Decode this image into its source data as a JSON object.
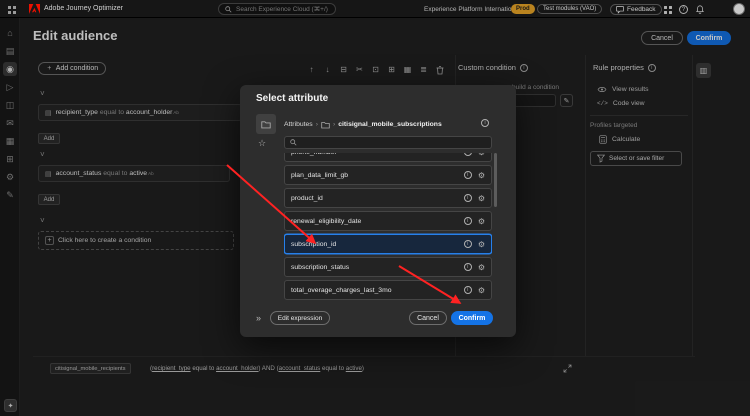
{
  "colors": {
    "accent_blue": "#1473e6",
    "selection_blue": "#2680eb",
    "arrow_red": "#ff2222",
    "env_badge_bg": "#b9831f"
  },
  "topbar": {
    "app_title": "Adobe Journey Optimizer",
    "search_placeholder": "Search Experience Cloud (⌘+/)",
    "org_name": "Experience Platform International...",
    "env_badge": "Prod",
    "sandbox_badge": "Test modules (VAO)",
    "feedback_label": "Feedback"
  },
  "sidebar": {
    "items": [
      {
        "name": "home",
        "glyph": "⌂"
      },
      {
        "name": "campaigns",
        "glyph": "▤"
      },
      {
        "name": "audiences",
        "glyph": "◉"
      },
      {
        "name": "journeys",
        "glyph": "▷"
      },
      {
        "name": "decisioning",
        "glyph": "◫"
      },
      {
        "name": "channels",
        "glyph": "✉"
      },
      {
        "name": "analysis",
        "glyph": "▦"
      },
      {
        "name": "assets",
        "glyph": "⊞"
      },
      {
        "name": "administration",
        "glyph": "⚙"
      },
      {
        "name": "configuration",
        "glyph": "✎"
      }
    ]
  },
  "header": {
    "title": "Edit audience",
    "cancel_label": "Cancel",
    "confirm_label": "Confirm"
  },
  "toolbar": {
    "icons": [
      {
        "name": "move-up",
        "glyph": "↑"
      },
      {
        "name": "move-down",
        "glyph": "↓"
      },
      {
        "name": "ungroup",
        "glyph": "⊟"
      },
      {
        "name": "cut",
        "glyph": "✂"
      },
      {
        "name": "copy",
        "glyph": "⊡"
      },
      {
        "name": "paste",
        "glyph": "⊞"
      },
      {
        "name": "group",
        "glyph": "▦"
      },
      {
        "name": "options",
        "glyph": "≣"
      }
    ]
  },
  "canvas": {
    "add_condition_label": "Add condition",
    "add_connector_label": "Add",
    "conditions": [
      {
        "attribute": "recipient_type",
        "operator": " equal to ",
        "value": "account_holder",
        "type_badge": "Ab"
      },
      {
        "attribute": "account_status",
        "operator": " equal to ",
        "value": "active",
        "type_badge": "Ab"
      }
    ],
    "placeholder_condition": "Click here to create a condition"
  },
  "custom_condition": {
    "title": "Custom condition",
    "hint_fragment": "build a condition"
  },
  "rule_properties": {
    "title": "Rule properties",
    "view_results": "View results",
    "code_view": "Code view",
    "profiles_label": "Profiles targeted",
    "calculate_label": "Calculate",
    "filter_button": "Select or save filter"
  },
  "modal": {
    "title": "Select attribute",
    "breadcrumb_root": "Attributes",
    "breadcrumb_leaf": "citisignal_mobile_subscriptions",
    "attributes": [
      {
        "label": "phone_number"
      },
      {
        "label": "plan_data_limit_gb"
      },
      {
        "label": "product_id"
      },
      {
        "label": "renewal_eligibility_date"
      },
      {
        "label": "subscription_id"
      },
      {
        "label": "subscription_status"
      },
      {
        "label": "total_overage_charges_last_3mo"
      }
    ],
    "selected_attribute": "subscription_id",
    "edit_expression_label": "Edit expression",
    "cancel_label": "Cancel",
    "confirm_label": "Confirm"
  },
  "footer_expression": {
    "audience_chip": "citisignal_mobile_recipients",
    "open": "(",
    "attr1": "recipient_type",
    "op1": " equal to ",
    "val1": "account_holder",
    "mid": ") AND (",
    "attr2": "account_status",
    "op2": " equal to ",
    "val2": "active",
    "close": ")"
  }
}
